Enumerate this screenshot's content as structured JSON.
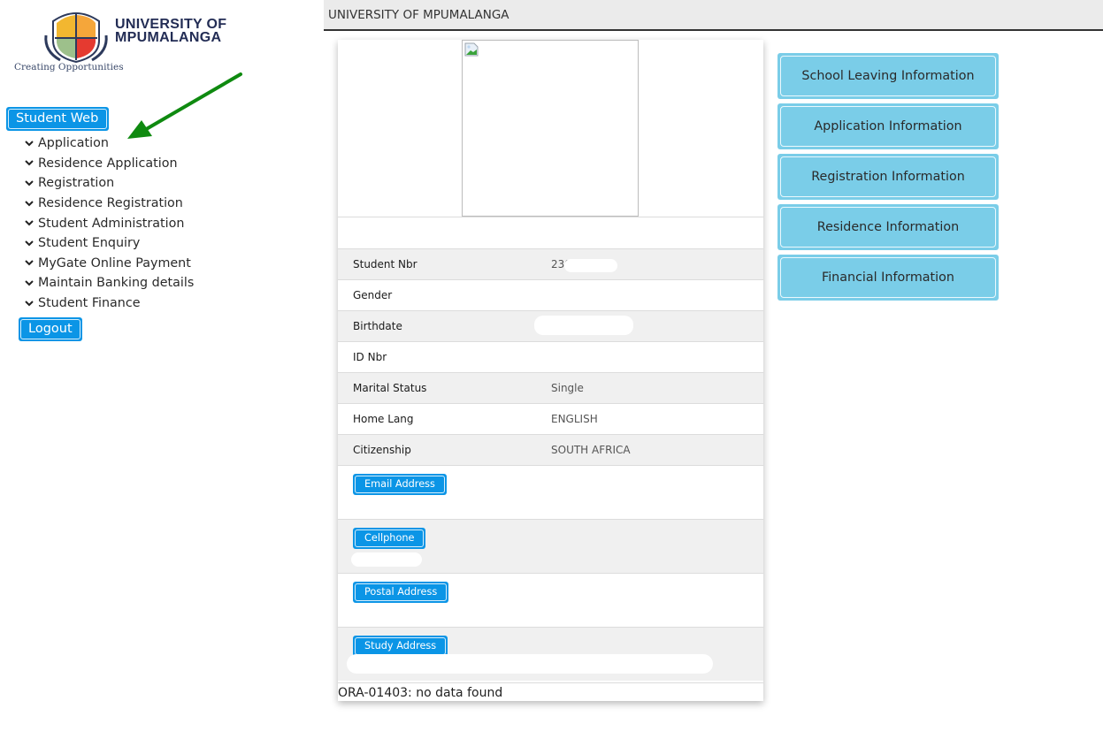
{
  "logo": {
    "title_line1": "UNIVERSITY OF",
    "title_line2": "MPUMALANGA",
    "tagline": "Creating Opportunities"
  },
  "sidebar": {
    "student_web_label": "Student Web",
    "menu": [
      {
        "label": "Application",
        "icon": "chevron-down-icon"
      },
      {
        "label": "Residence Application",
        "icon": "chevron-down-icon"
      },
      {
        "label": "Registration",
        "icon": "chevron-down-icon"
      },
      {
        "label": "Residence Registration",
        "icon": "chevron-down-icon"
      },
      {
        "label": "Student Administration",
        "icon": "chevron-down-icon"
      },
      {
        "label": "Student Enquiry",
        "icon": "chevron-down-icon"
      },
      {
        "label": "MyGate Online Payment",
        "icon": "chevron-down-icon"
      },
      {
        "label": "Maintain Banking details",
        "icon": "chevron-down-icon"
      },
      {
        "label": "Student Finance",
        "icon": "chevron-down-icon"
      }
    ],
    "logout_label": "Logout"
  },
  "header": {
    "title": "UNIVERSITY OF MPUMALANGA"
  },
  "profile": {
    "photo_icon": "broken-image-icon",
    "fields": [
      {
        "label": "Student Nbr",
        "value": "230"
      },
      {
        "label": "Gender",
        "value": ""
      },
      {
        "label": "Birthdate",
        "value": ""
      },
      {
        "label": "ID Nbr",
        "value": ""
      },
      {
        "label": "Marital Status",
        "value": "Single"
      },
      {
        "label": "Home Lang",
        "value": "ENGLISH"
      },
      {
        "label": "Citizenship",
        "value": "SOUTH AFRICA"
      }
    ],
    "contact_buttons": [
      {
        "label": "Email Address"
      },
      {
        "label": "Cellphone"
      },
      {
        "label": "Postal Address"
      },
      {
        "label": "Study Address"
      }
    ],
    "error_message": "ORA-01403: no data found"
  },
  "info_buttons": [
    {
      "label": "School Leaving Information"
    },
    {
      "label": "Application Information"
    },
    {
      "label": "Registration Information"
    },
    {
      "label": "Residence Information"
    },
    {
      "label": "Financial Information"
    }
  ],
  "colors": {
    "primary_button": "#0b95e6",
    "info_button": "#7acde8",
    "annotation_arrow": "#0f8a10",
    "header_bg": "#ebebeb",
    "alt_row_bg": "#f0f0f0"
  }
}
